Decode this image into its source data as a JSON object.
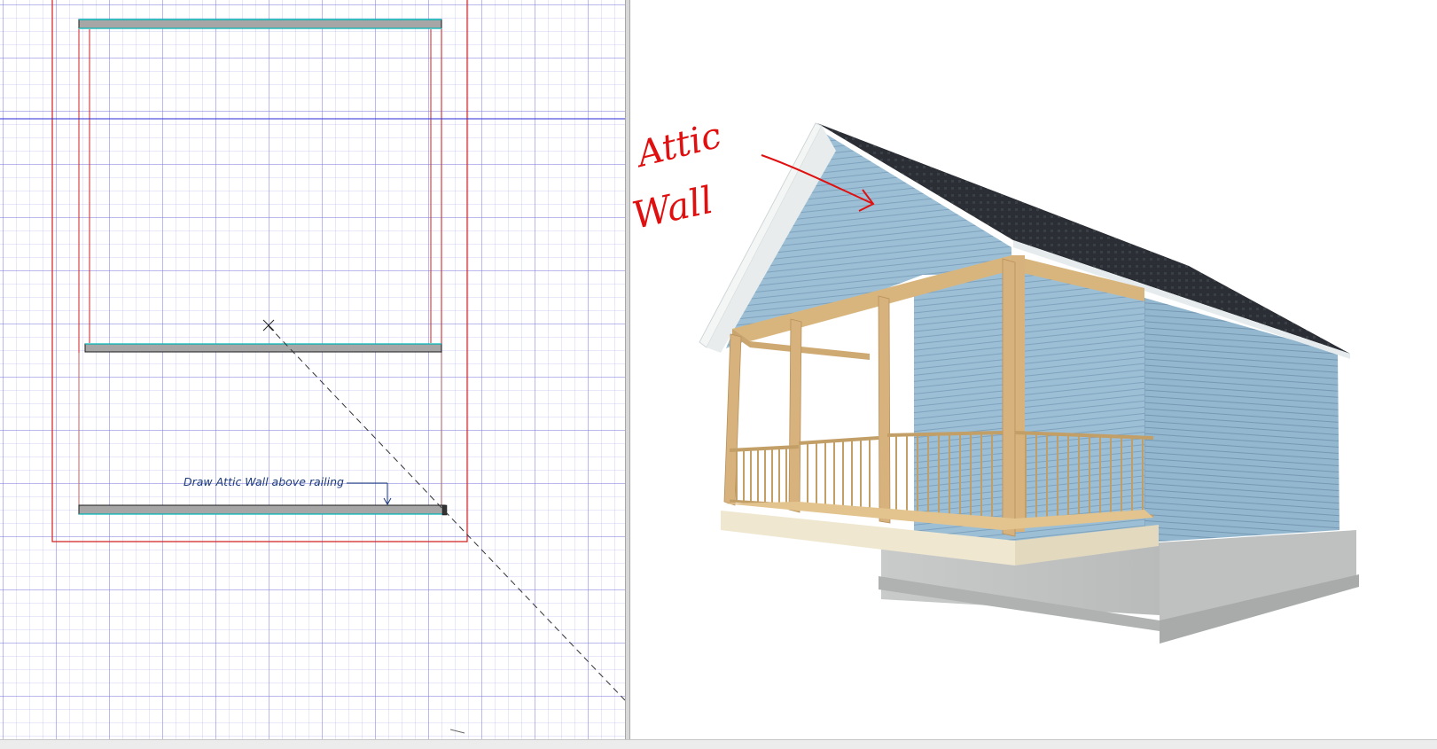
{
  "plan_view": {
    "callout_text": "Draw Attic Wall above railing"
  },
  "view_3d": {
    "annotation_line1": "Attic",
    "annotation_line2": "Wall",
    "annotation_color": "#e01010",
    "siding_color": "#9cbfd6",
    "roof_color": "#2b2f35",
    "post_color": "#d7b27c",
    "foundation_color": "#c3c5c5",
    "deck_edge_color": "#efe7cf"
  },
  "colors": {
    "grid_line": "#6e6ed7",
    "roof_outline": "#d22020",
    "reference_line": "#2a2ad8",
    "wall_fill": "#a6a6a6",
    "wall_edge": "#00b4b4"
  }
}
